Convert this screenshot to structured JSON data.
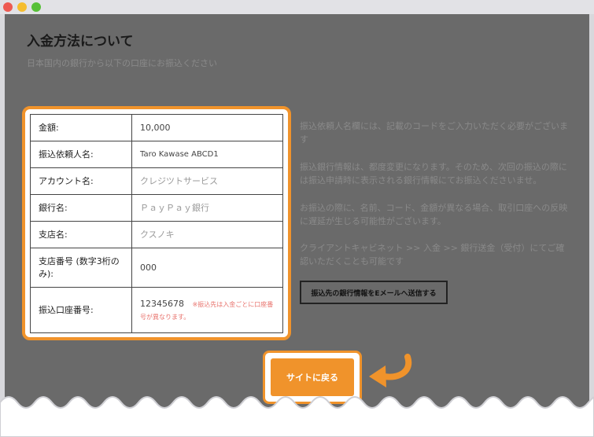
{
  "page": {
    "title": "入金方法について",
    "subtitle": "日本国内の銀行から以下の口座にお振込ください"
  },
  "table": {
    "rows": [
      {
        "label": "金額:",
        "value": "10,000"
      },
      {
        "label": "振込依頼人名:",
        "value": "Taro Kawase ABCD1"
      },
      {
        "label": "アカウント名:",
        "value": "クレジツトサービス"
      },
      {
        "label": "銀行名:",
        "value": "ＰａｙＰａｙ銀行"
      },
      {
        "label": "支店名:",
        "value": "クスノキ"
      },
      {
        "label": "支店番号 (数字3桁のみ):",
        "value": "000"
      },
      {
        "label": "振込口座番号:",
        "value": "12345678",
        "note": "※振込先は入金ごとに口座番号が異なります。"
      }
    ]
  },
  "side": {
    "p1": "振込依頼人名欄には、記載のコードをご入力いただく必要がございます",
    "p2": "振込銀行情報は、都度変更になります。そのため、次回の振込の際には振込申請時に表示される銀行情報にてお振込くださいませ。",
    "p3": "お振込の際に、名前、コード、金額が異なる場合、取引口座への反映に遅延が生じる可能性がございます。",
    "p4": "クライアントキャビネット >> 入金 >> 銀行送金（受付）にてご確認いただくことも可能です",
    "email_button": "振込先の銀行情報をEメールへ送信する"
  },
  "back_button": "サイトに戻る",
  "colors": {
    "accent": "#f0932b",
    "note": "#e8716b",
    "overlay": "#6a6a6a"
  }
}
